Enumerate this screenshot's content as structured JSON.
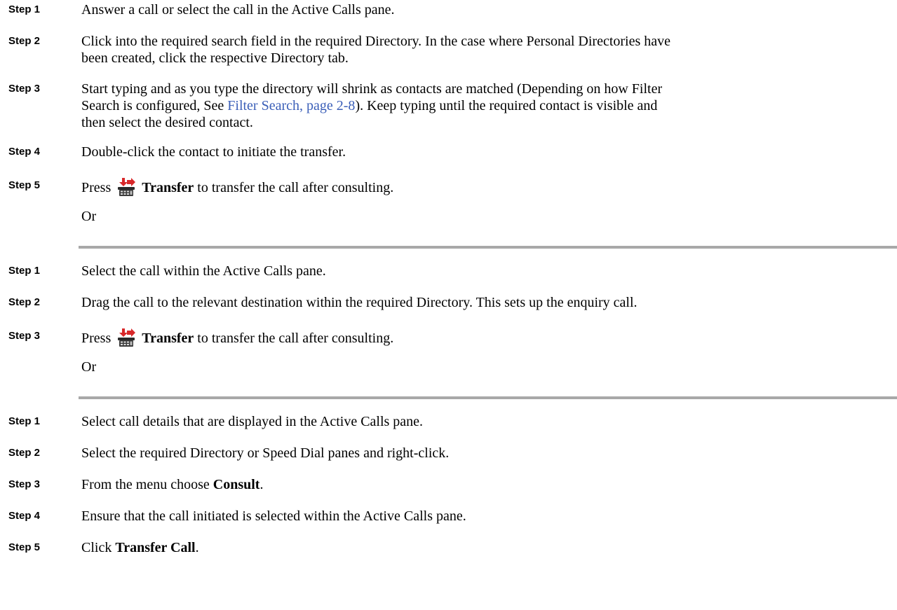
{
  "section1": {
    "steps": [
      {
        "label": "Step 1",
        "text": "Answer a call or select the call in the Active Calls pane."
      },
      {
        "label": "Step 2",
        "line1": "Click into the required search field in the required Directory. In the case where Personal Directories have",
        "line2": "been created, click the respective Directory tab."
      },
      {
        "label": "Step 3",
        "line1": "Start typing and as you type the directory will shrink as contacts are matched (Depending on how Filter",
        "line2_pre": "Search is configured, See ",
        "line2_link": "Filter Search, page 2-8",
        "line2_post": "). Keep typing until the required contact is visible and",
        "line3": "then select the desired contact."
      },
      {
        "label": "Step 4",
        "text": "Double-click the contact to initiate the transfer."
      },
      {
        "label": "Step 5",
        "pre": "Press",
        "bold": "Transfer",
        "post": "to transfer the call after consulting.",
        "icon": "transfer-phone-icon"
      }
    ],
    "or": "Or"
  },
  "section2": {
    "steps": [
      {
        "label": "Step 1",
        "text": "Select the call within the Active Calls pane."
      },
      {
        "label": "Step 2",
        "text": "Drag the call to the relevant destination within the required Directory. This sets up the enquiry call."
      },
      {
        "label": "Step 3",
        "pre": "Press",
        "bold": "Transfer",
        "post": "to transfer the call after consulting.",
        "icon": "transfer-phone-icon"
      }
    ],
    "or": "Or"
  },
  "section3": {
    "steps": [
      {
        "label": "Step 1",
        "text": "Select call details that are displayed in the Active Calls pane."
      },
      {
        "label": "Step 2",
        "text": "Select the required Directory or Speed Dial panes and right-click."
      },
      {
        "label": "Step 3",
        "pre": "From the menu choose ",
        "bold": "Consult",
        "post": "."
      },
      {
        "label": "Step 4",
        "text": "Ensure that the call initiated is selected within the Active Calls pane."
      },
      {
        "label": "Step 5",
        "pre": "Click ",
        "bold": "Transfer Call",
        "post": "."
      }
    ]
  },
  "colors": {
    "link": "#3b5fb8",
    "divider": "#a8a8a8",
    "icon_red": "#d8282a"
  }
}
